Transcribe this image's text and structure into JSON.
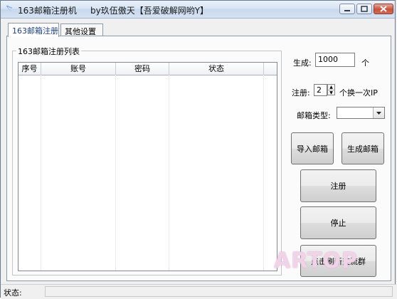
{
  "window": {
    "title": "163邮箱注册机     by玖伍傲天【吾爱破解网哟Y】",
    "buttons": {
      "minimize": "minimize-icon",
      "maximize": "maximize-icon",
      "close": "close-icon"
    }
  },
  "tabs": [
    {
      "label": "163邮箱注册",
      "active": true
    },
    {
      "label": "其他设置",
      "active": false
    }
  ],
  "group": {
    "label": "163邮箱注册列表"
  },
  "list": {
    "columns": [
      "序号",
      "账号",
      "密码",
      "状态"
    ],
    "rows": []
  },
  "form": {
    "generate_label": "生成:",
    "generate_value": "1000",
    "generate_unit": "个",
    "register_label": "注册:",
    "register_value": "2",
    "register_suffix": "个换一次IP",
    "mailtype_label": "邮箱类型:",
    "mailtype_value": ""
  },
  "buttons": {
    "import": "导入邮箱",
    "generate": "生成邮箱",
    "register": "注册",
    "stop": "停止",
    "bottom": "点击刷新交流群"
  },
  "watermark": "ARTOP",
  "status": {
    "label": "状态:",
    "text": ""
  },
  "colors": {
    "active_tab_text": "#1b3f8c",
    "close_button": "#c8523a"
  }
}
